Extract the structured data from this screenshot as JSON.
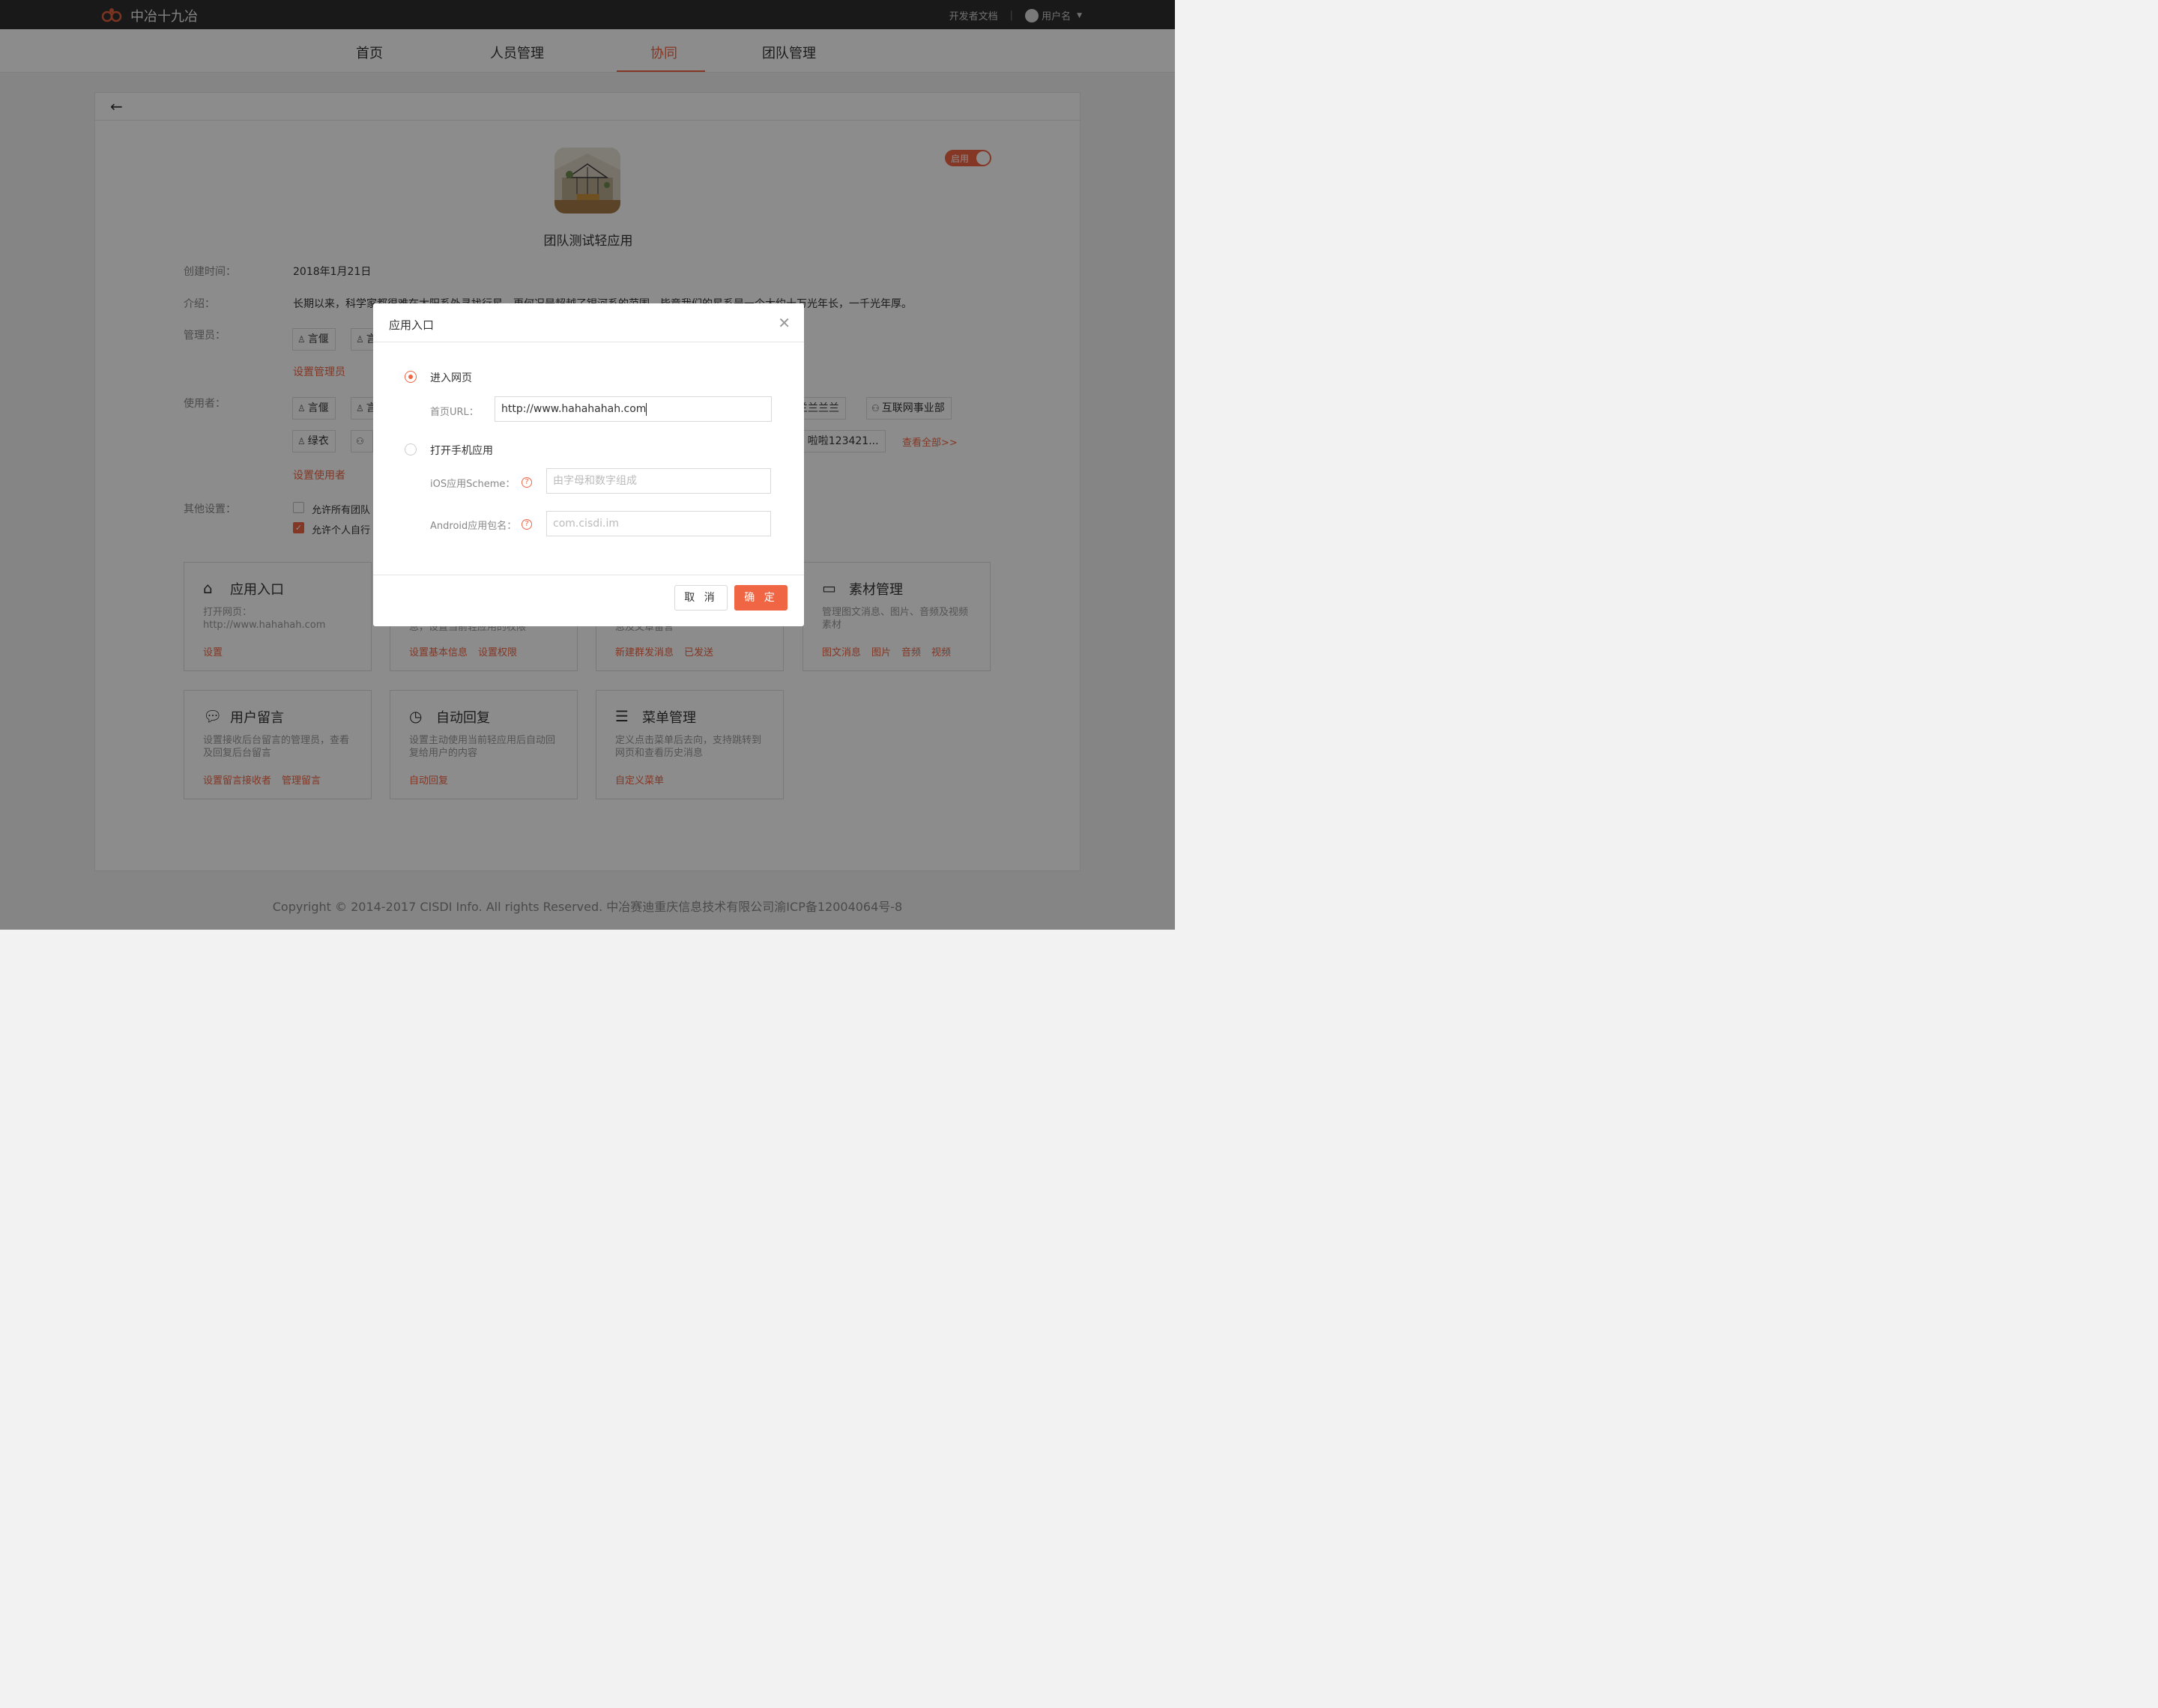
{
  "topbar": {
    "logo_text": "中冶十九冶",
    "dev_docs": "开发者文档",
    "separator": "|",
    "username": "用户名"
  },
  "nav": {
    "items": [
      {
        "label": "首页",
        "active": false
      },
      {
        "label": "人员管理",
        "active": false
      },
      {
        "label": "协同",
        "active": true
      },
      {
        "label": "团队管理",
        "active": false
      }
    ]
  },
  "app": {
    "name": "团队测试轻应用",
    "toggle_label": "启用"
  },
  "info": {
    "created_label": "创建时间：",
    "created_value": "2018年1月21日",
    "intro_label": "介绍：",
    "intro_value": "长期以来，科学家都很难在太阳系外寻找行星，更何况是超越了银河系的范围。毕竟我们的星系是一个大约十万光年长，一千光年厚。",
    "admin_label": "管理员：",
    "admins": [
      "言偃",
      "言"
    ],
    "set_admin": "设置管理员",
    "users_label": "使用者：",
    "users_row1": [
      "言偃",
      "言"
    ],
    "users_row1_right": [
      "兰兰兰兰",
      "互联网事业部"
    ],
    "users_row2": [
      "绿衣",
      ""
    ],
    "users_row2_right": "啦啦123421...",
    "view_all": "查看全部>>",
    "set_users": "设置使用者",
    "other_label": "其他设置：",
    "opt1": "允许所有团队",
    "opt2": "允许个人自行"
  },
  "features": [
    {
      "icon": "home-icon",
      "title": "应用入口",
      "desc": "打开网页：http://www.hahahah.com",
      "links": [
        "设置"
      ]
    },
    {
      "icon": "info-icon",
      "title": "",
      "desc": "息，设置当前轻应用的权限",
      "links": [
        "设置基本信息",
        "设置权限"
      ]
    },
    {
      "icon": "send-icon",
      "title": "",
      "desc": "息及文章留言",
      "links": [
        "新建群发消息",
        "已发送"
      ]
    },
    {
      "icon": "folder-icon",
      "title": "素材管理",
      "desc": "管理图文消息、图片、音频及视频素材",
      "links": [
        "图文消息",
        "图片",
        "音频",
        "视频"
      ]
    },
    {
      "icon": "chat-icon",
      "title": "用户留言",
      "desc": "设置接收后台留言的管理员，查看及回复后台留言",
      "links": [
        "设置留言接收者",
        "管理留言"
      ]
    },
    {
      "icon": "clock-icon",
      "title": "自动回复",
      "desc": "设置主动使用当前轻应用后自动回复给用户的内容",
      "links": [
        "自动回复"
      ]
    },
    {
      "icon": "list-icon",
      "title": "菜单管理",
      "desc": "定义点击菜单后去向，支持跳转到网页和查看历史消息",
      "links": [
        "自定义菜单"
      ]
    }
  ],
  "footer": "Copyright © 2014-2017 CISDI Info. All rights Reserved. 中冶赛迪重庆信息技术有限公司渝ICP备12004064号-8",
  "modal": {
    "title": "应用入口",
    "option_web": "进入网页",
    "url_label": "首页URL：",
    "url_value": "http://www.hahahahah.com",
    "option_app": "打开手机应用",
    "ios_label": "iOS应用Scheme：",
    "ios_placeholder": "由字母和数字组成",
    "android_label": "Android应用包名：",
    "android_placeholder": "com.cisdi.im",
    "cancel": "取 消",
    "ok": "确 定"
  },
  "colors": {
    "accent": "#f06543",
    "topbar": "#2e2e2e"
  }
}
